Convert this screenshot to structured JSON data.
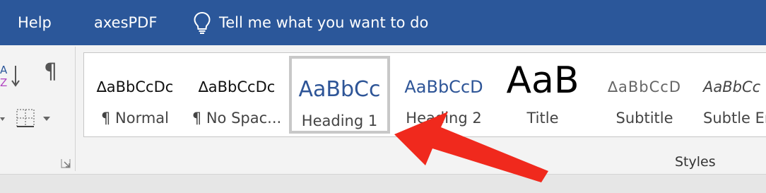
{
  "menubar": {
    "items": [
      "Help",
      "axesPDF"
    ],
    "tell_me": "Tell me what you want to do",
    "background": "#2b579a"
  },
  "styles_gallery": {
    "group_label": "Styles",
    "tiles": [
      {
        "preview": "∆aBbCcDc",
        "name": "¶ Normal"
      },
      {
        "preview": "∆aBbCcDc",
        "name": "¶ No Spac..."
      },
      {
        "preview": "AaBbCc",
        "name": "Heading 1",
        "selected": true
      },
      {
        "preview": "AaBbCcD",
        "name": "Heading 2"
      },
      {
        "preview": "AaB",
        "name": "Title"
      },
      {
        "preview": "∆aBbCcD",
        "name": "Subtitle"
      },
      {
        "preview": "AaBbCc",
        "name": "Subtle Em"
      }
    ]
  },
  "annotation": {
    "arrow_color": "#f0291d"
  },
  "icons": [
    "lightbulb-icon",
    "sort-az-icon",
    "pilcrow-icon",
    "borders-icon",
    "dialog-launcher-icon",
    "red-arrow-icon"
  ]
}
